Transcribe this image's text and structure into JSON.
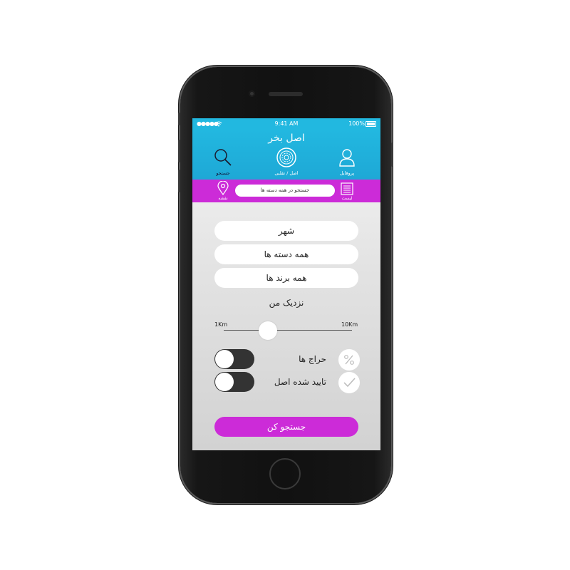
{
  "status_bar": {
    "signal": "●●●●●",
    "time": "9:41 AM",
    "battery": "100%"
  },
  "header": {
    "title": "اصل بخر",
    "nav": [
      {
        "label": "جستجو",
        "icon": "search-icon"
      },
      {
        "label": "اصل / تقلبی",
        "icon": "original-fake-badge-icon"
      },
      {
        "label": "پروفایل",
        "icon": "profile-icon"
      }
    ]
  },
  "subbar": {
    "map_label": "نقشه",
    "search_placeholder": "جستجو در همه دسته ها",
    "list_label": "لیست"
  },
  "filters": {
    "city": "شهر",
    "categories": "همه دسته ها",
    "brands": "همه برند ها",
    "near_me": "نزدیک من",
    "range_min": "1Km",
    "range_max": "10Km",
    "distance_fraction": 0.3
  },
  "options": [
    {
      "label": "حراج ها",
      "icon": "percent-icon",
      "enabled": false
    },
    {
      "label": "تایید شده اصل",
      "icon": "checkmark-icon",
      "enabled": false
    }
  ],
  "search_button": "جستجو کن",
  "colors": {
    "header_blue": "#22b8e0",
    "accent_magenta": "#cc2bd8",
    "toggle_dark": "#333333"
  }
}
